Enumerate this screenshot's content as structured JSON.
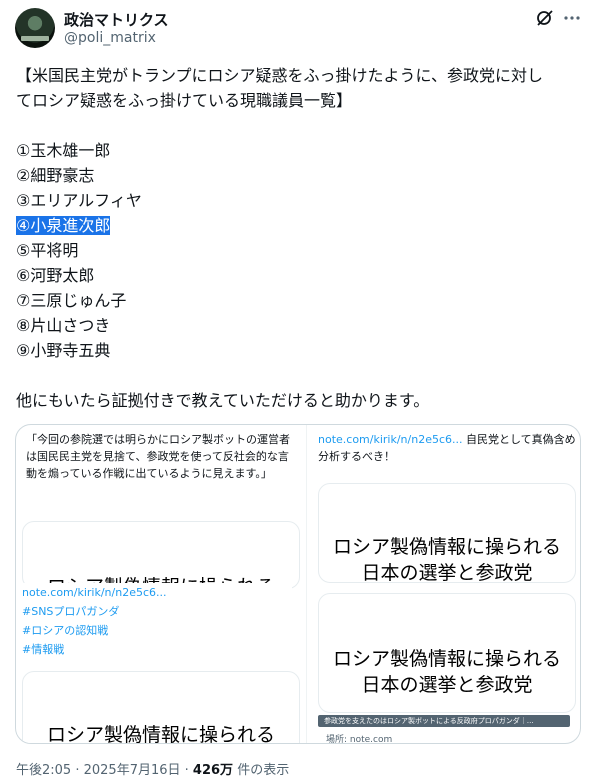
{
  "author": {
    "display_name": "政治マトリクス",
    "handle": "@poli_matrix"
  },
  "icons": {
    "grok": "grok-icon",
    "more": "more-icon"
  },
  "tweet": {
    "lines": [
      "【米国民主党がトランプにロシア疑惑をふっ掛けたように、参政党に対し",
      "てロシア疑惑をふっ掛けている現職議員一覧】",
      "",
      "①玉木雄一郎",
      "②細野豪志",
      "③エリアルフィヤ",
      "④小泉進次郎",
      "⑤平将明",
      "⑥河野太郎",
      "⑦三原じゅん子",
      "⑧片山さつき",
      "⑨小野寺五典",
      "",
      "他にもいたら証拠付きで教えていただけると助かります。"
    ],
    "highlighted_line_index": 6
  },
  "card": {
    "quote_text": "「今回の参院選では明らかにロシア製ボットの運営者は国民民主党を見捨て、参政党を使って反社会的な言動を煽っている作戦に出ているように見えます。」",
    "article_title_short": "ロシア製偽情報に操られる",
    "article_title_line1": "ロシア製偽情報に操られる",
    "article_title_line2": "日本の選挙と参政党",
    "link_text": "note.com/kirik/n/n2e5c6...",
    "hashtags": [
      "#SNSプロパガンダ",
      "#ロシアの認知戦",
      "#情報戦"
    ],
    "right_link": "note.com/kirik/n/n2e5c6...",
    "right_text": " 自民党として真偽含め分析するべき！",
    "caption": "参政党を支えたのはロシア製ボットによる反政府プロパガンダ｜…",
    "source": "場所: note.com"
  },
  "meta": {
    "time": "午後2:05",
    "sep": " · ",
    "date": "2025年7月16日",
    "views_value": "426万",
    "views_label": " 件の表示"
  }
}
